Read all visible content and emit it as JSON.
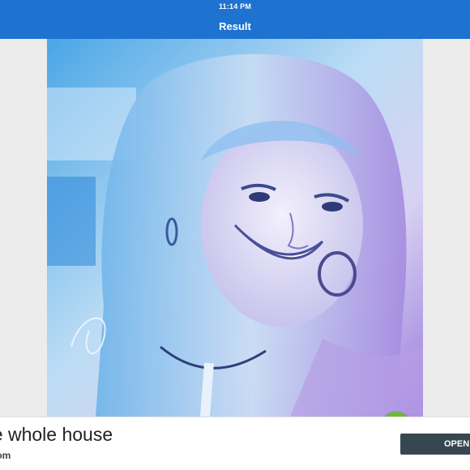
{
  "status_bar": {
    "time": "11:14 PM"
  },
  "app_bar": {
    "title": "Result"
  },
  "result": {
    "fab_icon": "plus-icon",
    "accent": "#6dbb2f"
  },
  "ad": {
    "headline": "he whole house",
    "url": "o.com",
    "open_label": "OPEN"
  },
  "colors": {
    "app_bar": "#1e72d0",
    "open_button": "#37474f"
  }
}
